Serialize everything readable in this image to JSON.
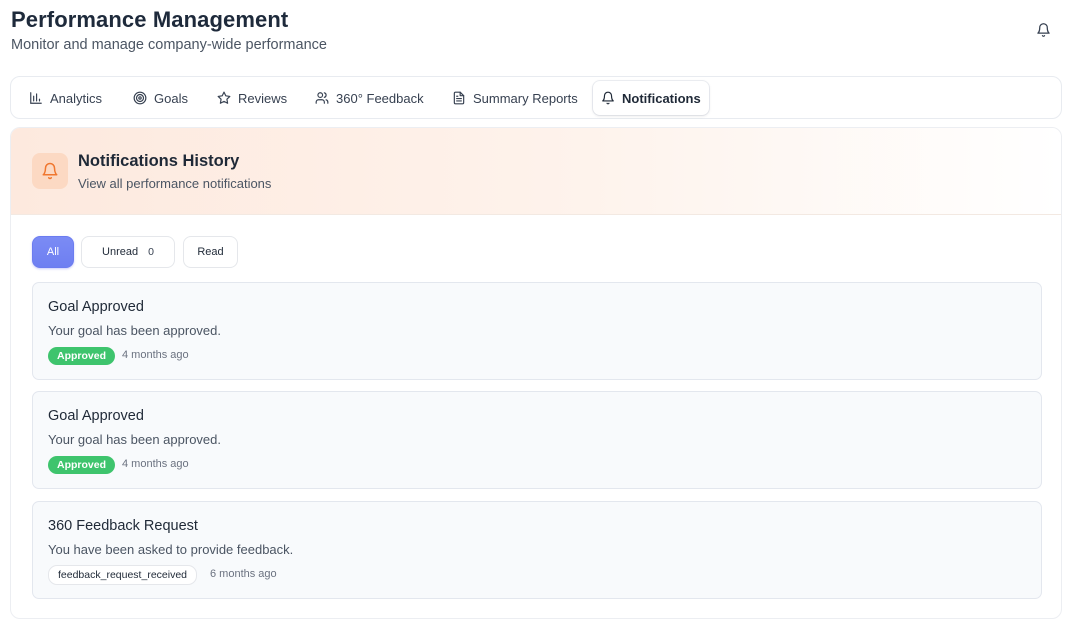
{
  "header": {
    "title": "Performance Management",
    "subtitle": "Monitor and manage company-wide performance",
    "bell_icon": "bell-icon"
  },
  "tabs": [
    {
      "label": "Analytics",
      "icon": "bar-chart-icon",
      "active": false
    },
    {
      "label": "Goals",
      "icon": "target-icon",
      "active": false
    },
    {
      "label": "Reviews",
      "icon": "star-icon",
      "active": false
    },
    {
      "label": "360° Feedback",
      "icon": "users-icon",
      "active": false
    },
    {
      "label": "Summary Reports",
      "icon": "file-text-icon",
      "active": false
    },
    {
      "label": "Notifications",
      "icon": "bell-icon",
      "active": true
    }
  ],
  "panel": {
    "title": "Notifications History",
    "subtitle": "View all performance notifications",
    "icon": "bell-icon"
  },
  "filters": {
    "all": "All",
    "unread": "Unread",
    "unread_count": "0",
    "read": "Read",
    "active": "All"
  },
  "notifications": [
    {
      "title": "Goal Approved",
      "message": "Your goal has been approved.",
      "badge": "Approved",
      "time": "4 months ago"
    },
    {
      "title": "Goal Approved",
      "message": "Your goal has been approved.",
      "badge": "Approved",
      "time": "4 months ago"
    },
    {
      "title": "360 Feedback Request",
      "message": "You have been asked to provide feedback.",
      "badge": "feedback_request_received",
      "time": "6 months ago"
    }
  ],
  "colors": {
    "accent": "#6e7ff1",
    "approved": "#3ec46d",
    "header_gradient": "#fde9de",
    "icon_bg": "#fcd9c3",
    "icon_stroke": "#f0772f"
  }
}
